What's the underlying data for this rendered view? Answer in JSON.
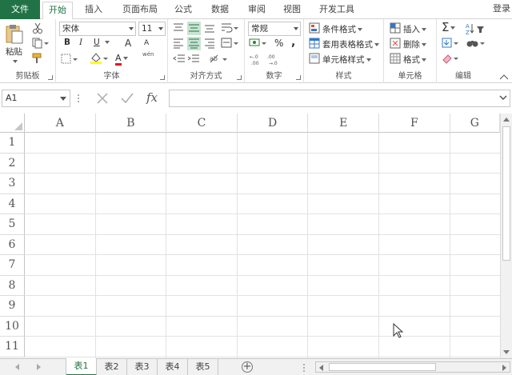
{
  "tabs": {
    "file": "文件",
    "items": [
      "开始",
      "插入",
      "页面布局",
      "公式",
      "数据",
      "审阅",
      "视图",
      "开发工具"
    ],
    "login": "登录"
  },
  "ribbon": {
    "clipboard": {
      "label": "剪贴板",
      "paste": "粘贴"
    },
    "font": {
      "label": "字体",
      "font_name": "宋体",
      "font_size": "11",
      "bold": "B",
      "italic": "I",
      "underline": "U",
      "grow": "A",
      "shrink": "A",
      "wen": "wén"
    },
    "align": {
      "label": "对齐方式"
    },
    "number": {
      "label": "数字",
      "format": "常规",
      "percent": "%",
      "comma": ","
    },
    "styles": {
      "label": "样式",
      "conditional": "条件格式",
      "table_format": "套用表格格式",
      "cell_styles": "单元格样式"
    },
    "cells": {
      "label": "单元格",
      "insert": "插入",
      "delete": "删除",
      "format": "格式"
    },
    "editing": {
      "label": "编辑",
      "sum": "Σ"
    }
  },
  "formula_bar": {
    "name_box": "A1",
    "fx": "fx",
    "value": ""
  },
  "grid": {
    "columns": [
      "A",
      "B",
      "C",
      "D",
      "E",
      "F",
      "G"
    ],
    "rows": [
      "1",
      "2",
      "3",
      "4",
      "5",
      "6",
      "7",
      "8",
      "9",
      "10",
      "11"
    ]
  },
  "sheets": {
    "items": [
      "表1",
      "表2",
      "表3",
      "表4",
      "表5"
    ],
    "active": 0,
    "add": "+"
  },
  "colors": {
    "accent": "#217346"
  }
}
